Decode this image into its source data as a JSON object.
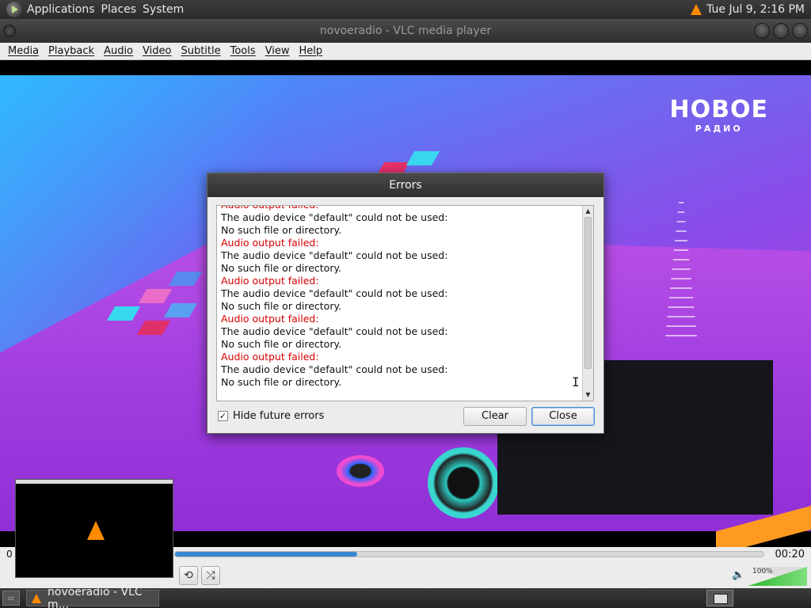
{
  "top_panel": {
    "menus": [
      "Applications",
      "Places",
      "System"
    ],
    "clock": "Tue Jul  9,  2:16 PM"
  },
  "window": {
    "title": "novoeradio - VLC media player"
  },
  "menubar": {
    "items": [
      "Media",
      "Playback",
      "Audio",
      "Video",
      "Subtitle",
      "Tools",
      "View",
      "Help"
    ]
  },
  "video": {
    "logo_main": "НОВОЕ",
    "logo_sub": "РАДИО"
  },
  "player": {
    "time_elapsed": "0",
    "time_total": "00:20",
    "progress": 0.31,
    "volume_label": "100%",
    "volume_level": 1.0
  },
  "dialog": {
    "title": "Errors",
    "log_lines": [
      {
        "text": "Audio output failed:",
        "type": "error"
      },
      {
        "text": "The audio device \"default\" could not be used:",
        "type": "info"
      },
      {
        "text": "No such file or directory.",
        "type": "info"
      },
      {
        "text": "Audio output failed:",
        "type": "error"
      },
      {
        "text": "The audio device \"default\" could not be used:",
        "type": "info"
      },
      {
        "text": "No such file or directory.",
        "type": "info"
      },
      {
        "text": "Audio output failed:",
        "type": "error"
      },
      {
        "text": "The audio device \"default\" could not be used:",
        "type": "info"
      },
      {
        "text": "No such file or directory.",
        "type": "info"
      },
      {
        "text": "Audio output failed:",
        "type": "error"
      },
      {
        "text": "The audio device \"default\" could not be used:",
        "type": "info"
      },
      {
        "text": "No such file or directory.",
        "type": "info"
      },
      {
        "text": "Audio output failed:",
        "type": "error"
      },
      {
        "text": "The audio device \"default\" could not be used:",
        "type": "info"
      },
      {
        "text": "No such file or directory.",
        "type": "info"
      }
    ],
    "hide_future_errors_label": "Hide future errors",
    "hide_future_errors_checked": true,
    "clear_label": "Clear",
    "close_label": "Close"
  },
  "taskbar": {
    "task_label": "novoeradio - VLC m..."
  },
  "colors": {
    "error_text": "#d40000",
    "accent": "#3a86d0",
    "vlc_orange": "#ff8c00"
  },
  "icons": {
    "vlc": "vlc-cone-icon",
    "apps": "gnome-foot-icon",
    "volume": "speaker-icon"
  }
}
